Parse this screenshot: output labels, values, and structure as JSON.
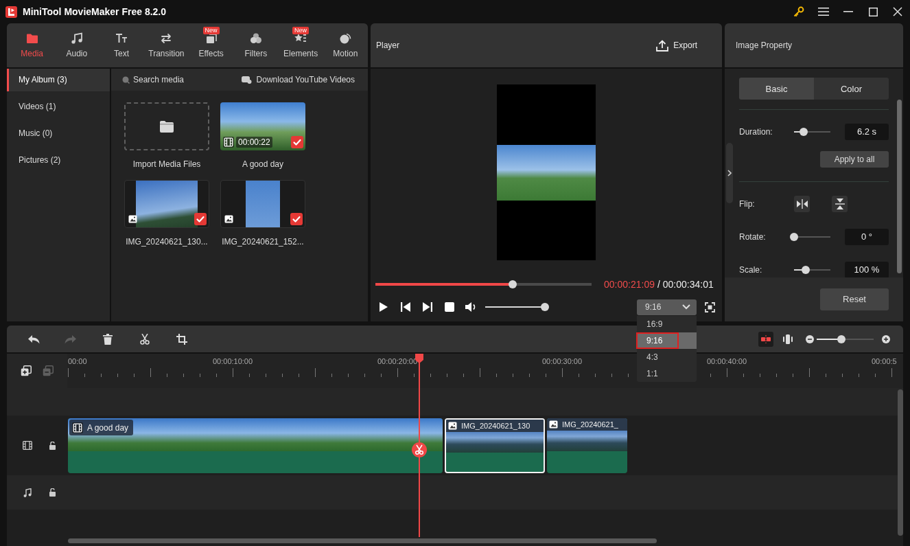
{
  "window": {
    "title": "MiniTool MovieMaker Free 8.2.0"
  },
  "tool_tabs": [
    {
      "label": "Media",
      "selected": true
    },
    {
      "label": "Audio",
      "selected": false
    },
    {
      "label": "Text",
      "selected": false
    },
    {
      "label": "Transition",
      "selected": false
    },
    {
      "label": "Effects",
      "selected": false,
      "badge": "New"
    },
    {
      "label": "Filters",
      "selected": false
    },
    {
      "label": "Elements",
      "selected": false,
      "badge": "New"
    },
    {
      "label": "Motion",
      "selected": false
    }
  ],
  "sidebar": {
    "items": [
      {
        "label": "My Album (3)",
        "selected": true
      },
      {
        "label": "Videos (1)",
        "selected": false
      },
      {
        "label": "Music (0)",
        "selected": false
      },
      {
        "label": "Pictures (2)",
        "selected": false
      }
    ]
  },
  "media": {
    "search": {
      "placeholder": "Search media"
    },
    "download_link": "Download YouTube Videos",
    "import_tile": {
      "label": "Import Media Files"
    },
    "items": [
      {
        "kind": "video",
        "duration": "00:00:22",
        "checked": true,
        "label": "A good day"
      },
      {
        "kind": "image",
        "checked": true,
        "label": "IMG_20240621_130..."
      },
      {
        "kind": "image",
        "checked": true,
        "label": "IMG_20240621_152..."
      }
    ]
  },
  "player": {
    "title": "Player",
    "export_button": "Export",
    "progress": {
      "level": 0.635
    },
    "current_time": "00:00:21:09",
    "total_time": "/ 00:00:34:01",
    "volume": {
      "level": 1
    },
    "aspect_ratio": {
      "value": "9:16",
      "expanded": true,
      "options": [
        {
          "label": "16:9",
          "selected": false
        },
        {
          "label": "9:16",
          "selected": true
        },
        {
          "label": "4:3",
          "selected": false
        },
        {
          "label": "1:1",
          "selected": false
        }
      ]
    }
  },
  "property": {
    "title": "Image Property",
    "tabs": [
      {
        "label": "Basic",
        "selected": true
      },
      {
        "label": "Color",
        "selected": false
      }
    ],
    "duration": {
      "label": "Duration:",
      "level": 0.26,
      "value": "6.2 s"
    },
    "apply_button": "Apply to all",
    "flip": {
      "label": "Flip:"
    },
    "rotate": {
      "label": "Rotate:",
      "level": 0,
      "value": "0 °"
    },
    "scale": {
      "label": "Scale:",
      "level": 0.32,
      "value": "100 %"
    },
    "reset_button": "Reset"
  },
  "timeline": {
    "undo": {
      "disabled": false
    },
    "redo": {
      "disabled": true
    },
    "snap": {
      "on": true
    },
    "zoom": {
      "level": 0.43
    },
    "remove_track": {
      "disabled": true
    },
    "ruler_labels": [
      "00:00",
      "00:00:10:00",
      "00:00:20:00",
      "00:00:30:00",
      "00:00:40:00",
      "00:00:5"
    ],
    "tracks": [
      {
        "kind": "video",
        "clips": [
          {
            "kind": "video",
            "label": "A good day",
            "selected": false
          },
          {
            "kind": "image",
            "label": "IMG_20240621_130",
            "selected": true
          },
          {
            "kind": "image",
            "label": "IMG_20240621_",
            "selected": false
          }
        ]
      },
      {
        "kind": "audio"
      }
    ]
  }
}
